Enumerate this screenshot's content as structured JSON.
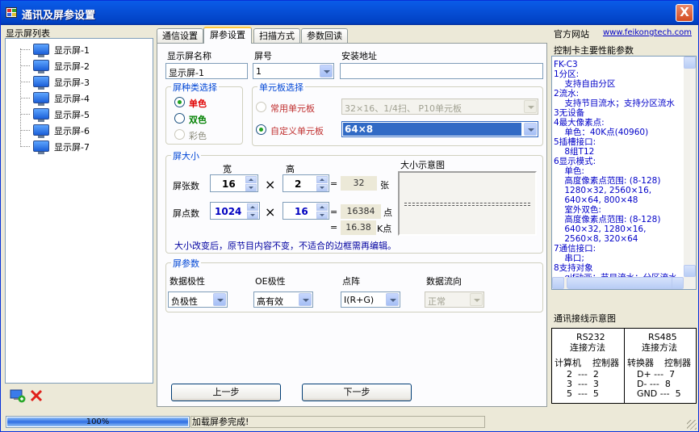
{
  "window": {
    "title": "通讯及屏参设置",
    "close_glyph": "X"
  },
  "left": {
    "label": "显示屏列表",
    "screens": [
      "显示屏-1",
      "显示屏-2",
      "显示屏-3",
      "显示屏-4",
      "显示屏-5",
      "显示屏-6",
      "显示屏-7"
    ]
  },
  "tabs": [
    "通信设置",
    "屏参设置",
    "扫描方式",
    "参数回读"
  ],
  "form": {
    "name_label": "显示屏名称",
    "name_value": "显示屏-1",
    "number_label": "屏号",
    "number_value": "1",
    "address_label": "安装地址",
    "address_value": "",
    "color_group": "屏种类选择",
    "color_options": [
      "单色",
      "双色",
      "彩色"
    ],
    "board_group": "单元板选择",
    "common_board_label": "常用单元板",
    "common_board_value": "32×16、1/4扫、 P10单元板",
    "custom_board_label": "自定义单元板",
    "custom_board_value": "64×8",
    "size_group": "屏大小",
    "width_label": "宽",
    "height_label": "高",
    "screen_count_label": "屏张数",
    "screen_count_w": "16",
    "screen_count_h": "2",
    "times": "×",
    "equals": "=",
    "screen_count_total": "32",
    "screen_count_unit": "张",
    "dots_label": "屏点数",
    "dots_w": "1024",
    "dots_h": "16",
    "dots_total": "16384",
    "dots_unit": "点",
    "dots_k": "16.38",
    "dots_k_unit": "K点",
    "preview_label": "大小示意图",
    "note": "大小改变后，原节目内容不变，不适合的边框需再编辑。",
    "param_group": "屏参数",
    "data_polarity_label": "数据极性",
    "data_polarity_value": "负极性",
    "oe_label": "OE极性",
    "oe_value": "高有效",
    "dot_label": "点阵",
    "dot_value": "I(R+G)",
    "flow_label": "数据流向",
    "flow_value": "正常",
    "prev_button": "上一步",
    "next_button": "下一步"
  },
  "right": {
    "site_label": "官方网站",
    "site_url": "www.feikongtech.com",
    "specs_title": "控制卡主要性能参数",
    "specs_lines": [
      "FK-C3",
      "1分区:",
      "    支持自由分区",
      "2流水:",
      "    支持节目流水；支持分区流水",
      "3无设备",
      "4最大像素点:",
      "    单色：40K点(40960)",
      "5插槽接口:",
      "    8组T12",
      "6显示模式:",
      "    单色:",
      "    高度像素点范围: (8-128)",
      "    1280×32, 2560×16,",
      "    640×64, 800×48",
      "    室外双色:",
      "    高度像素点范围: (8-128)",
      "    640×32, 1280×16,",
      "    2560×8, 320×64",
      "7通信接口:",
      "    串口;",
      "8支持对象",
      "    gif动画；节目流水；分区流水"
    ],
    "wiring_label": "通讯接线示意图",
    "rs232_title": "RS232",
    "rs232_sub": "连接方法",
    "rs232_cols": [
      "计算机",
      "控制器"
    ],
    "rs232_rows": [
      "2  ---  2",
      "3  ---  3",
      "5  ---  5"
    ],
    "rs485_title": "RS485",
    "rs485_sub": "连接方法",
    "rs485_cols": [
      "转换器",
      "控制器"
    ],
    "rs485_rows": [
      "D+ ---  7",
      "D- ---  8",
      "GND ---  5"
    ]
  },
  "status": {
    "progress_text": "100%",
    "progress_value": 1.0,
    "message": "加载屏参完成!"
  },
  "colors": {
    "title_blue": "#0054e3",
    "group_title": "#0046d5",
    "red_label": "#e00000",
    "green_label": "#008000",
    "spec_blue": "#0000c8"
  }
}
